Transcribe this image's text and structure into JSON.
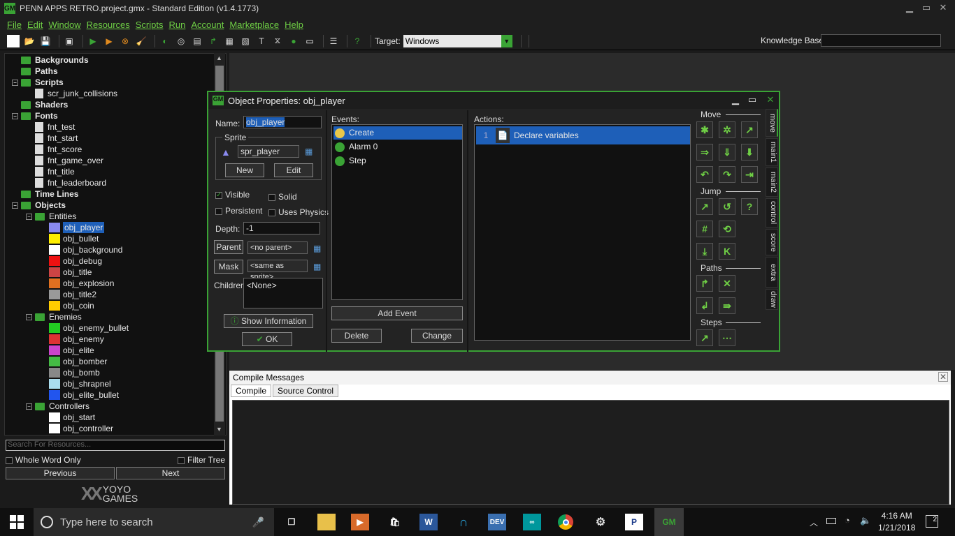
{
  "window": {
    "title": "PENN APPS RETRO.project.gmx  -  Standard Edition (v1.4.1773)",
    "min": "▁",
    "max": "▭",
    "close": "✕"
  },
  "menu": [
    "File",
    "Edit",
    "Window",
    "Resources",
    "Scripts",
    "Run",
    "Account",
    "Marketplace",
    "Help"
  ],
  "toolbar": {
    "target_label": "Target:",
    "target_value": "Windows",
    "knowledge_label": "Knowledge Base:",
    "knowledge_value": ""
  },
  "tree": {
    "items": [
      {
        "label": "Backgrounds",
        "level": 0,
        "type": "folder",
        "bold": true
      },
      {
        "label": "Paths",
        "level": 0,
        "type": "folder",
        "bold": true
      },
      {
        "label": "Scripts",
        "level": 0,
        "type": "folder",
        "bold": true,
        "expanded": true
      },
      {
        "label": "scr_junk_collisions",
        "level": 1,
        "type": "doc"
      },
      {
        "label": "Shaders",
        "level": 0,
        "type": "folder",
        "bold": true
      },
      {
        "label": "Fonts",
        "level": 0,
        "type": "folder",
        "bold": true,
        "expanded": true
      },
      {
        "label": "fnt_test",
        "level": 1,
        "type": "doc"
      },
      {
        "label": "fnt_start",
        "level": 1,
        "type": "doc"
      },
      {
        "label": "fnt_score",
        "level": 1,
        "type": "doc"
      },
      {
        "label": "fnt_game_over",
        "level": 1,
        "type": "doc"
      },
      {
        "label": "fnt_title",
        "level": 1,
        "type": "doc"
      },
      {
        "label": "fnt_leaderboard",
        "level": 1,
        "type": "doc"
      },
      {
        "label": "Time Lines",
        "level": 0,
        "type": "folder",
        "bold": true
      },
      {
        "label": "Objects",
        "level": 0,
        "type": "folder",
        "bold": true,
        "expanded": true
      },
      {
        "label": "Entities",
        "level": 1,
        "type": "folder",
        "expanded": true
      },
      {
        "label": "obj_player",
        "level": 2,
        "type": "sprite",
        "color": "#8a8af0",
        "selected": true
      },
      {
        "label": "obj_bullet",
        "level": 2,
        "type": "sprite",
        "color": "#ffee00"
      },
      {
        "label": "obj_background",
        "level": 2,
        "type": "sprite",
        "color": "#ffffff"
      },
      {
        "label": "obj_debug",
        "level": 2,
        "type": "sprite",
        "color": "#ee1111"
      },
      {
        "label": "obj_title",
        "level": 2,
        "type": "sprite",
        "color": "#cc4444"
      },
      {
        "label": "obj_explosion",
        "level": 2,
        "type": "sprite",
        "color": "#e07020"
      },
      {
        "label": "obj_title2",
        "level": 2,
        "type": "sprite",
        "color": "#999999"
      },
      {
        "label": "obj_coin",
        "level": 2,
        "type": "sprite",
        "color": "#ffcc00"
      },
      {
        "label": "Enemies",
        "level": 1,
        "type": "folder",
        "expanded": true
      },
      {
        "label": "obj_enemy_bullet",
        "level": 2,
        "type": "sprite",
        "color": "#22cc22"
      },
      {
        "label": "obj_enemy",
        "level": 2,
        "type": "sprite",
        "color": "#dd3333"
      },
      {
        "label": "obj_elite",
        "level": 2,
        "type": "sprite",
        "color": "#cc44cc"
      },
      {
        "label": "obj_bomber",
        "level": 2,
        "type": "sprite",
        "color": "#44bb44"
      },
      {
        "label": "obj_bomb",
        "level": 2,
        "type": "sprite",
        "color": "#888888"
      },
      {
        "label": "obj_shrapnel",
        "level": 2,
        "type": "sprite",
        "color": "#aaddee"
      },
      {
        "label": "obj_elite_bullet",
        "level": 2,
        "type": "sprite",
        "color": "#2255ee"
      },
      {
        "label": "Controllers",
        "level": 1,
        "type": "folder",
        "expanded": true
      },
      {
        "label": "obj_start",
        "level": 2,
        "type": "sprite",
        "color": "#ffffff"
      },
      {
        "label": "obj_controller",
        "level": 2,
        "type": "sprite",
        "color": "#ffffff"
      }
    ],
    "search_placeholder": "Search For Resources...",
    "whole_word": "Whole Word Only",
    "filter_tree": "Filter Tree",
    "previous": "Previous",
    "next": "Next",
    "logo_top": "YOYO",
    "logo_bottom": "GAMES"
  },
  "dialog": {
    "title": "Object Properties: obj_player",
    "name_label": "Name:",
    "name_value": "obj_player",
    "sprite_label": "Sprite",
    "sprite_value": "spr_player",
    "new": "New",
    "edit": "Edit",
    "visible": "Visible",
    "solid": "Solid",
    "persistent": "Persistent",
    "uses_physics": "Uses Physics",
    "depth_label": "Depth:",
    "depth_value": "-1",
    "parent": "Parent",
    "parent_value": "<no parent>",
    "mask": "Mask",
    "mask_value": "<same as sprite>",
    "children_label": "Children:",
    "children_value": "<None>",
    "show_info": "Show Information",
    "ok": "OK",
    "events_label": "Events:",
    "events": [
      {
        "label": "Create",
        "color": "#e8c84a",
        "selected": true
      },
      {
        "label": "Alarm 0",
        "color": "#3aa335"
      },
      {
        "label": "Step",
        "color": "#3aa335"
      }
    ],
    "add_event": "Add Event",
    "delete": "Delete",
    "change": "Change",
    "actions_label": "Actions:",
    "actions": [
      {
        "num": "1",
        "label": "Declare variables"
      }
    ],
    "sections": {
      "move": "Move",
      "jump": "Jump",
      "paths": "Paths",
      "steps": "Steps"
    },
    "tabs": [
      "move",
      "main1",
      "main2",
      "control",
      "score",
      "extra",
      "draw"
    ]
  },
  "compile": {
    "title": "Compile Messages",
    "tabs": [
      "Compile",
      "Source Control"
    ]
  },
  "taskbar": {
    "search_placeholder": "Type here to search",
    "time": "4:16 AM",
    "date": "1/21/2018",
    "notif": "2"
  },
  "colors": {
    "accent": "#3aa335",
    "selection": "#1e5fb8"
  }
}
